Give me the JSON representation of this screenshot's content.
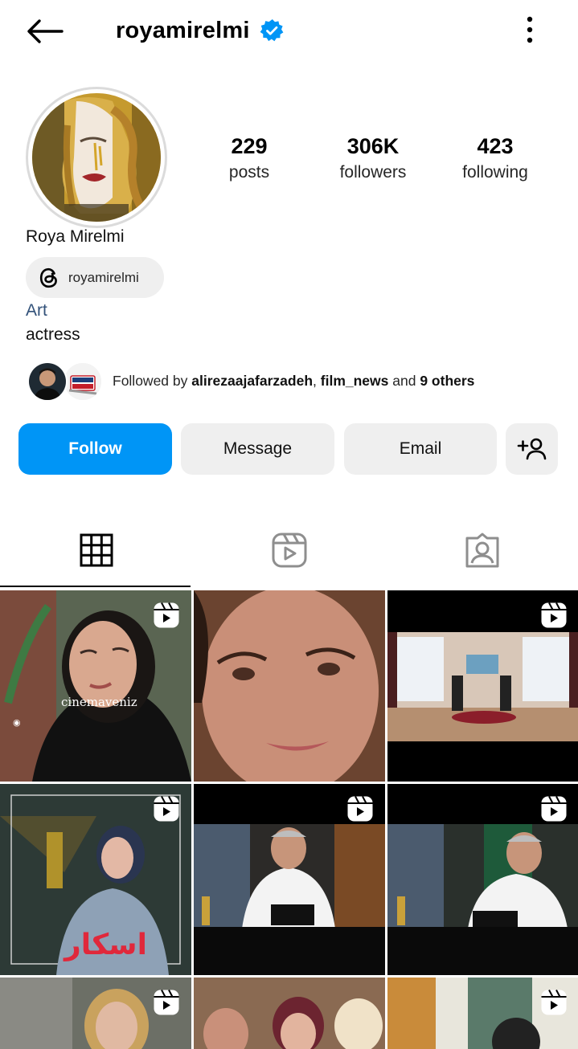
{
  "header": {
    "username": "royamirelmi",
    "verified": true,
    "accent_color": "#0095f6"
  },
  "profile": {
    "full_name": "Roya Mirelmi",
    "threads_handle": "royamirelmi",
    "category": "Art",
    "bio": "actress",
    "stats": {
      "posts_count": "229",
      "posts_label": "posts",
      "followers_count": "306K",
      "followers_label": "followers",
      "following_count": "423",
      "following_label": "following"
    }
  },
  "followed_by": {
    "prefix": "Followed by ",
    "user1": "alirezaajafarzadeh",
    "sep": ", ",
    "user2": "film_news",
    "and": " and ",
    "others": "9 others"
  },
  "actions": {
    "follow_label": "Follow",
    "message_label": "Message",
    "email_label": "Email"
  },
  "tabs": [
    {
      "icon": "grid-icon",
      "active": true
    },
    {
      "icon": "reels-icon",
      "active": false
    },
    {
      "icon": "tagged-icon",
      "active": false
    }
  ],
  "posts": [
    {
      "is_reel": true,
      "caption": "cinemaveniz"
    },
    {
      "is_reel": false
    },
    {
      "is_reel": true
    },
    {
      "is_reel": true
    },
    {
      "is_reel": true
    },
    {
      "is_reel": true
    },
    {
      "is_reel": true
    },
    {
      "is_reel": false
    },
    {
      "is_reel": true
    }
  ]
}
